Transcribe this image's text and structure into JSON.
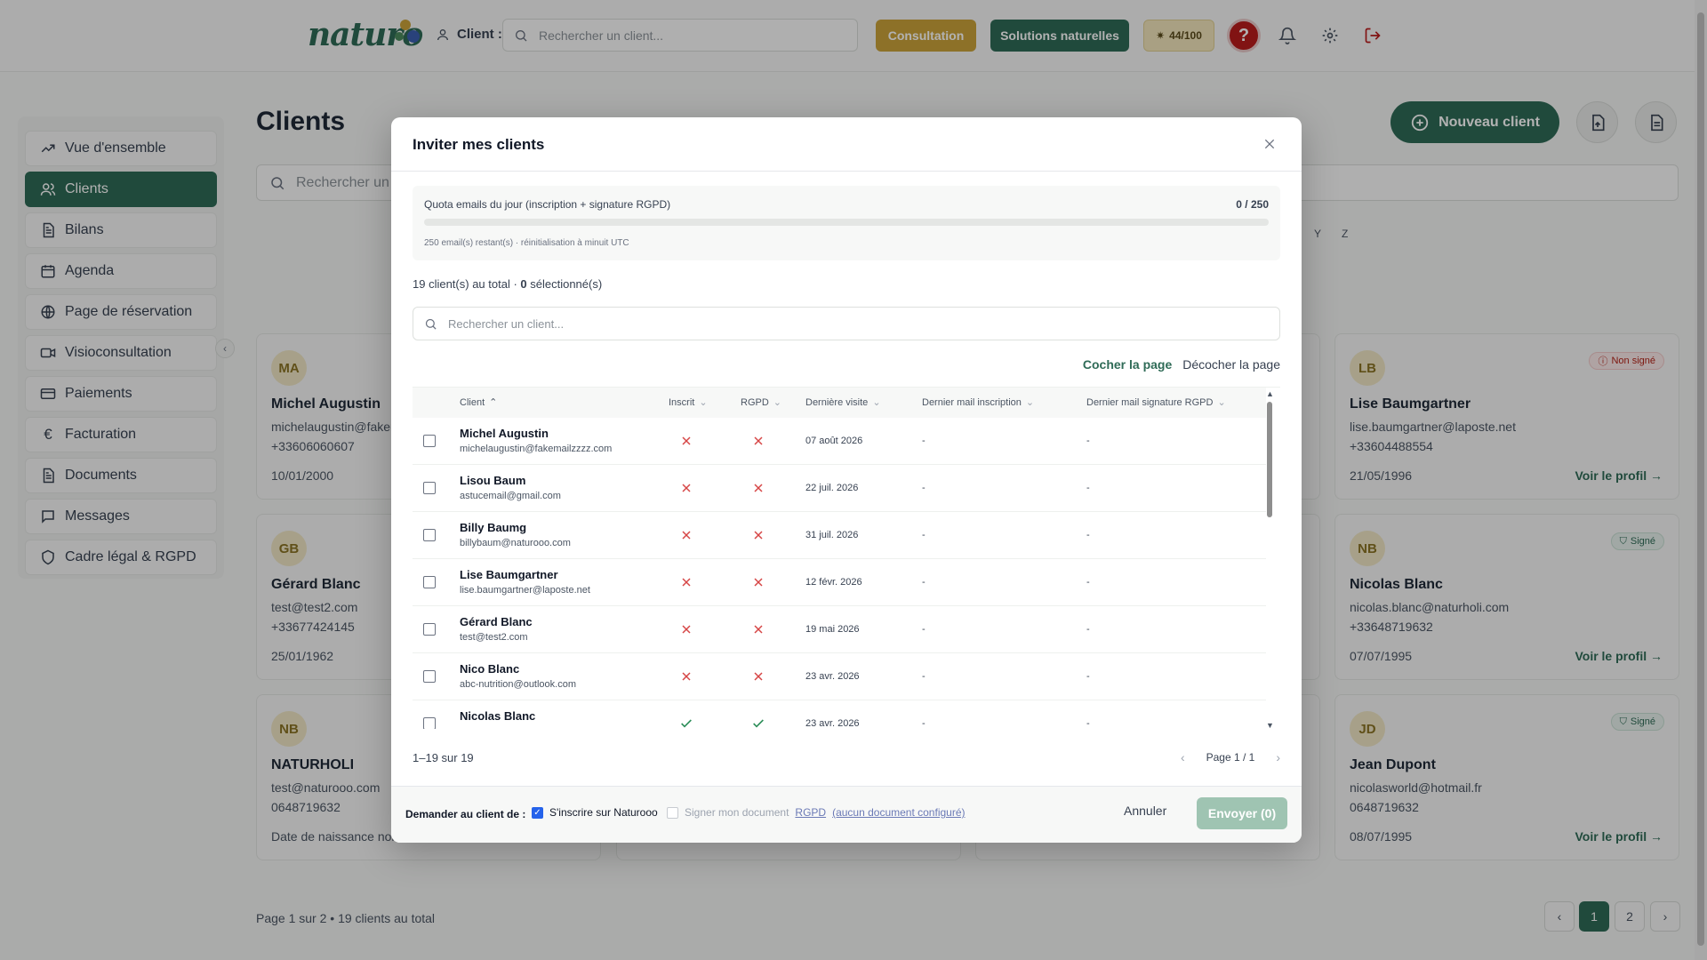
{
  "header": {
    "logo_text": "naturo",
    "client_label": "Client :",
    "search_placeholder": "Rechercher un client...",
    "consultation_label": "Consultation",
    "solutions_label": "Solutions naturelles",
    "score_label": "44/100",
    "help_label": "?"
  },
  "sidebar": {
    "items": [
      {
        "label": "Vue d'ensemble",
        "icon": "trend-icon"
      },
      {
        "label": "Clients",
        "icon": "users-icon"
      },
      {
        "label": "Bilans",
        "icon": "document-icon"
      },
      {
        "label": "Agenda",
        "icon": "calendar-icon"
      },
      {
        "label": "Page de réservation",
        "icon": "globe-icon"
      },
      {
        "label": "Visioconsultation",
        "icon": "video-icon"
      },
      {
        "label": "Paiements",
        "icon": "card-icon"
      },
      {
        "label": "Facturation",
        "icon": "euro-icon"
      },
      {
        "label": "Documents",
        "icon": "document-icon"
      },
      {
        "label": "Messages",
        "icon": "message-icon"
      },
      {
        "label": "Cadre légal & RGPD",
        "icon": "shield-icon"
      }
    ],
    "active_index": 1
  },
  "page": {
    "title": "Clients",
    "new_client_label": "Nouveau client",
    "search_placeholder": "Rechercher un c",
    "alpha_y": "Y",
    "alpha_z": "Z",
    "pagination_text": "Page 1 sur 2 • 19 clients au total",
    "pages": [
      "1",
      "2"
    ],
    "cards": [
      {
        "initials": "MA",
        "name": "Michel Augustin",
        "email": "michelaugustin@faker",
        "phone": "+33606060607",
        "date": "10/01/2000"
      },
      {
        "initials": "GB",
        "name": "Gérard Blanc",
        "email": "test@test2.com",
        "phone": "+33677424145",
        "date": "25/01/1962"
      },
      {
        "initials": "NB",
        "name": "NATURHOLI",
        "email": "test@naturooo.com",
        "phone": "0648719632",
        "date": "Date de naissance non"
      },
      {
        "initials": "LB",
        "name": "Lise Baumgartner",
        "email": "lise.baumgartner@laposte.net",
        "phone": "+33604488554",
        "date": "21/05/1996",
        "badge": "Non signé",
        "profile": "Voir le profil"
      },
      {
        "initials": "NB",
        "name": "Nicolas Blanc",
        "email": "nicolas.blanc@naturholi.com",
        "phone": "+33648719632",
        "date": "07/07/1995",
        "badge": "Signé",
        "profile": "Voir le profil"
      },
      {
        "initials": "JD",
        "name": "Jean Dupont",
        "email": "nicolasworld@hotmail.fr",
        "phone": "0648719632",
        "date": "08/07/1995",
        "badge": "Signé",
        "profile": "Voir le profil"
      }
    ]
  },
  "modal": {
    "title": "Inviter mes clients",
    "quota_label": "Quota emails du jour (inscription + signature RGPD)",
    "quota_count": "0 / 250",
    "quota_fraction": 0,
    "quota_note": "250 email(s) restant(s) · réinitialisation à minuit UTC",
    "total_prefix": "19 client(s) au total · ",
    "selected_count": "0",
    "selected_suffix": " sélectionné(s)",
    "search_placeholder": "Rechercher un client...",
    "check_page": "Cocher la page",
    "uncheck_page": "Décocher la page",
    "columns": {
      "client": "Client",
      "inscrit": "Inscrit",
      "rgpd": "RGPD",
      "last_visit": "Dernière visite",
      "last_mail_signup": "Dernier mail inscription",
      "last_mail_rgpd": "Dernier mail signature RGPD"
    },
    "rows": [
      {
        "name": "Michel Augustin",
        "email": "michelaugustin@fakemailzzzz.com",
        "inscrit": false,
        "rgpd": false,
        "visit": "07 août 2026",
        "mail_signup": "-",
        "mail_rgpd": "-"
      },
      {
        "name": "Lisou Baum",
        "email": "astucemail@gmail.com",
        "inscrit": false,
        "rgpd": false,
        "visit": "22 juil. 2026",
        "mail_signup": "-",
        "mail_rgpd": "-"
      },
      {
        "name": "Billy Baumg",
        "email": "billybaum@naturooo.com",
        "inscrit": false,
        "rgpd": false,
        "visit": "31 juil. 2026",
        "mail_signup": "-",
        "mail_rgpd": "-"
      },
      {
        "name": "Lise Baumgartner",
        "email": "lise.baumgartner@laposte.net",
        "inscrit": false,
        "rgpd": false,
        "visit": "12 févr. 2026",
        "mail_signup": "-",
        "mail_rgpd": "-"
      },
      {
        "name": "Gérard Blanc",
        "email": "test@test2.com",
        "inscrit": false,
        "rgpd": false,
        "visit": "19 mai 2026",
        "mail_signup": "-",
        "mail_rgpd": "-"
      },
      {
        "name": "Nico Blanc",
        "email": "abc-nutrition@outlook.com",
        "inscrit": false,
        "rgpd": false,
        "visit": "23 avr. 2026",
        "mail_signup": "-",
        "mail_rgpd": "-"
      },
      {
        "name": "Nicolas Blanc",
        "email": "",
        "inscrit": true,
        "rgpd": true,
        "visit": "23 avr. 2026",
        "mail_signup": "-",
        "mail_rgpd": "-"
      }
    ],
    "range_text": "1–19 sur 19",
    "page_text": "Page 1 / 1",
    "ask_label": "Demander au client de :",
    "opt_signup": "S'inscrire sur Naturooo",
    "opt_sign_prefix": "Signer mon document",
    "opt_sign_link": "RGPD",
    "opt_sign_config": "(aucun document configuré)",
    "cancel_label": "Annuler",
    "send_label": "Envoyer (0)"
  },
  "colors": {
    "brand_green": "#2f6b57",
    "gold": "#caa33a",
    "danger": "#d64545",
    "success": "#2f8f5b"
  }
}
